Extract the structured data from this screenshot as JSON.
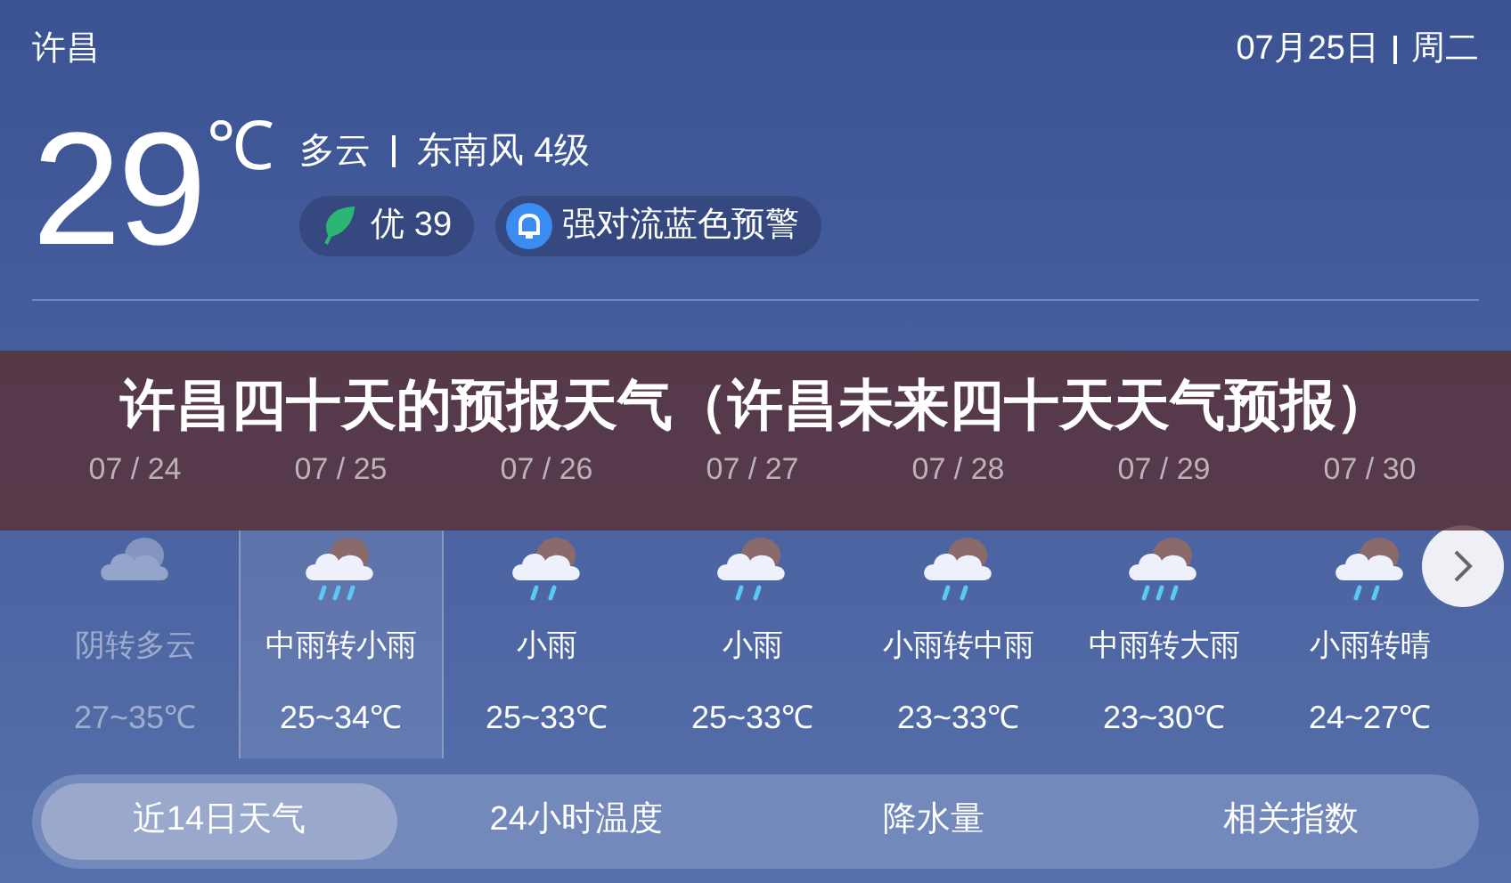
{
  "header": {
    "city": "许昌",
    "date": "07月25日",
    "weekday": "周二"
  },
  "current": {
    "temperature": "29",
    "unit": "℃",
    "condition": "多云",
    "wind": "东南风 4级",
    "air_quality": "优 39",
    "alert": "强对流蓝色预警"
  },
  "banner": {
    "title": "许昌四十天的预报天气（许昌未来四十天天气预报）"
  },
  "forecast": [
    {
      "date": "07 / 24",
      "condition": "阴转多云",
      "temperature": "27~35℃",
      "kind": "cloud",
      "past": true,
      "selected": false
    },
    {
      "date": "07 / 25",
      "condition": "中雨转小雨",
      "temperature": "25~34℃",
      "kind": "heavy-rain",
      "past": false,
      "selected": true
    },
    {
      "date": "07 / 26",
      "condition": "小雨",
      "temperature": "25~33℃",
      "kind": "light-rain",
      "past": false,
      "selected": false
    },
    {
      "date": "07 / 27",
      "condition": "小雨",
      "temperature": "25~33℃",
      "kind": "light-rain",
      "past": false,
      "selected": false
    },
    {
      "date": "07 / 28",
      "condition": "小雨转中雨",
      "temperature": "23~33℃",
      "kind": "light-rain",
      "past": false,
      "selected": false
    },
    {
      "date": "07 / 29",
      "condition": "中雨转大雨",
      "temperature": "23~30℃",
      "kind": "heavy-rain",
      "past": false,
      "selected": false
    },
    {
      "date": "07 / 30",
      "condition": "小雨转晴",
      "temperature": "24~27℃",
      "kind": "light-rain",
      "past": false,
      "selected": false
    }
  ],
  "tabs": [
    {
      "label": "近14日天气",
      "selected": true
    },
    {
      "label": "24小时温度",
      "selected": false
    },
    {
      "label": "降水量",
      "selected": false
    },
    {
      "label": "相关指数",
      "selected": false
    }
  ]
}
